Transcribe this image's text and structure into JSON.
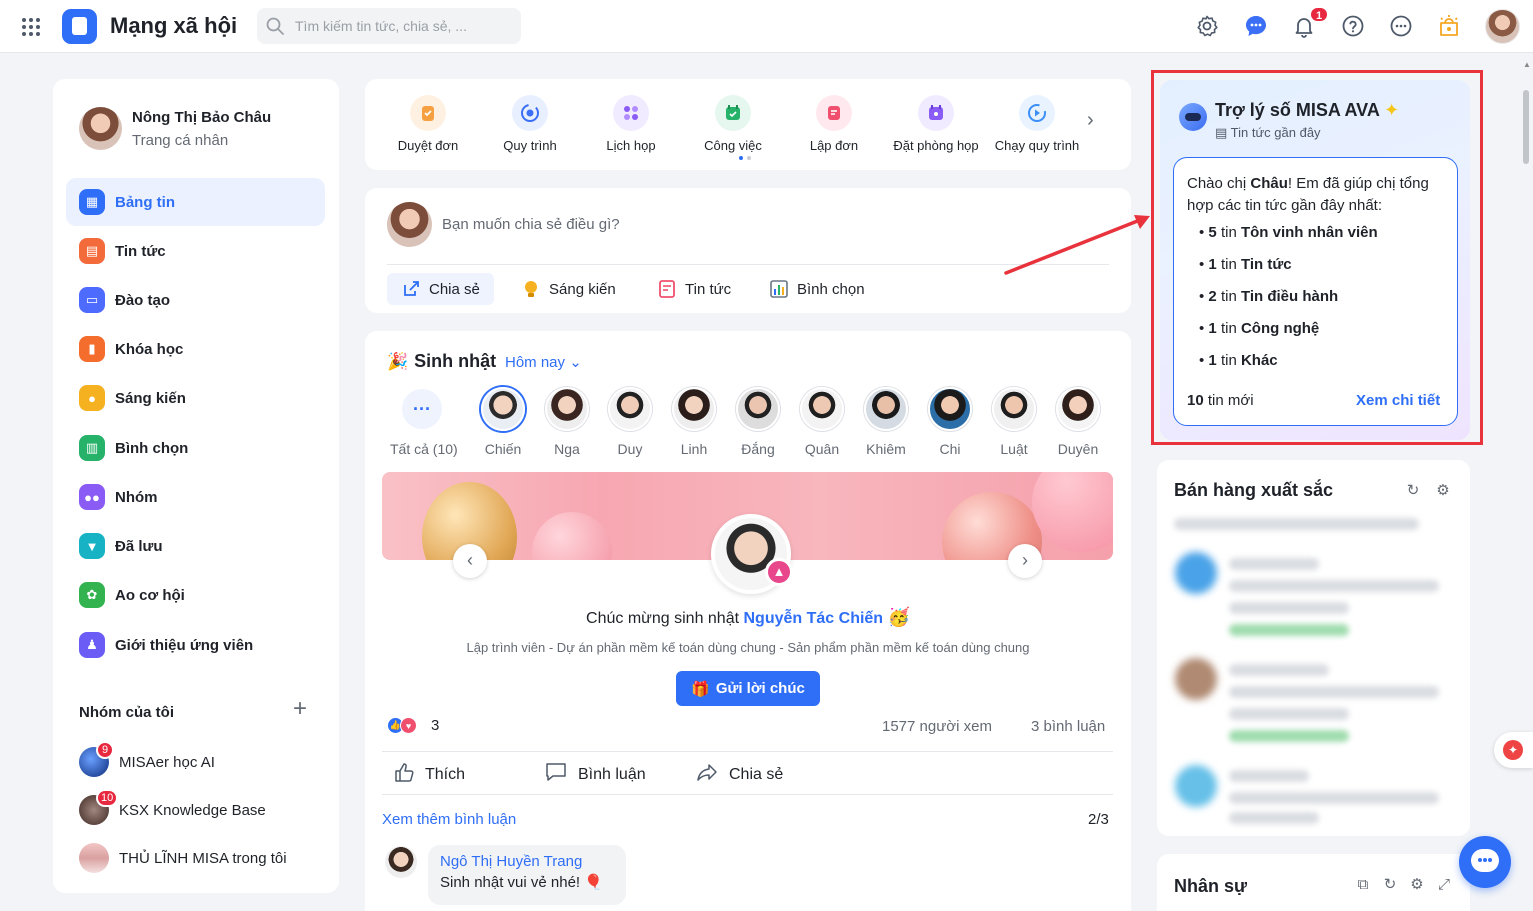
{
  "header": {
    "app_title": "Mạng xã hội",
    "search_placeholder": "Tìm kiếm tin tức, chia sẻ, ...",
    "notification_count": "1",
    "icons": [
      "grid-icon",
      "settings-icon",
      "chat-icon",
      "bell-icon",
      "help-icon",
      "more-icon",
      "lightbulb-icon"
    ]
  },
  "sidebar": {
    "profile": {
      "name": "Nông Thị Bảo Châu",
      "subtitle": "Trang cá nhân"
    },
    "menu": [
      {
        "label": "Bảng tin",
        "icon": "newsfeed-icon",
        "color": "#2f6ef6",
        "active": true
      },
      {
        "label": "Tin tức",
        "icon": "news-icon",
        "color": "#f36b3b"
      },
      {
        "label": "Đào tạo",
        "icon": "training-icon",
        "color": "#4d6bfe"
      },
      {
        "label": "Khóa học",
        "icon": "course-icon",
        "color": "#f56d2d"
      },
      {
        "label": "Sáng kiến",
        "icon": "idea-icon",
        "color": "#f5b120"
      },
      {
        "label": "Bình chọn",
        "icon": "poll-icon",
        "color": "#27b26a"
      },
      {
        "label": "Nhóm",
        "icon": "group-icon",
        "color": "#8a5cf5"
      },
      {
        "label": "Đã lưu",
        "icon": "bookmark-icon",
        "color": "#17b3c4"
      },
      {
        "label": "Ao cơ hội",
        "icon": "opportunity-icon",
        "color": "#32b350"
      },
      {
        "label": "Giới thiệu ứng viên",
        "icon": "referral-icon",
        "color": "#6a5cf5"
      }
    ],
    "groups_title": "Nhóm của tôi",
    "groups": [
      {
        "name": "MISAer học AI",
        "badge": "9"
      },
      {
        "name": "KSX Knowledge Base",
        "badge": "10"
      },
      {
        "name": "THỦ LĨNH MISA trong tôi",
        "badge": ""
      }
    ]
  },
  "apps": [
    {
      "label": "Duyệt đơn",
      "color": "#f5a142"
    },
    {
      "label": "Quy trình",
      "color": "#3b6ff6"
    },
    {
      "label": "Lịch họp",
      "color": "#8a5cf5"
    },
    {
      "label": "Công việc",
      "color": "#27b26a"
    },
    {
      "label": "Lập đơn",
      "color": "#f0506e"
    },
    {
      "label": "Đặt phòng họp",
      "color": "#8a5cf5"
    },
    {
      "label": "Chạy quy trình",
      "color": "#3b8ff6"
    }
  ],
  "composer": {
    "placeholder": "Bạn muốn chia sẻ điều gì?",
    "actions": [
      "Chia sẻ",
      "Sáng kiến",
      "Tin tức",
      "Bình chọn"
    ]
  },
  "birthday": {
    "title": "Sinh nhật",
    "filter": "Hôm nay",
    "people": [
      "Tất cả (10)",
      "Chiến",
      "Nga",
      "Duy",
      "Linh",
      "Đắng",
      "Quân",
      "Khiêm",
      "Chi",
      "Luật",
      "Duyên"
    ],
    "congrats_prefix": "Chúc mừng sinh nhật",
    "celebrant": "Nguyễn Tác Chiến",
    "job": "Lập trình viên - Dự án phần mềm kế toán dùng chung - Sản phẩm phần mềm kế toán dùng chung",
    "send_button": "Gửi lời chúc",
    "reaction_count": "3",
    "views": "1577 người xem",
    "comments": "3 bình luận",
    "actions": [
      "Thích",
      "Bình luận",
      "Chia sẻ"
    ],
    "more_comments": "Xem thêm bình luận",
    "pager": "2/3",
    "comment": {
      "author": "Ngô Thị Huyền Trang",
      "text": "Sinh nhật vui vẻ nhé!"
    }
  },
  "ava": {
    "title": "Trợ lý số MISA AVA",
    "subtitle": "Tin tức gần đây",
    "greet_1": "Chào chị ",
    "greet_name": "Châu",
    "greet_2": "! Em đã giúp chị tổng hợp các tin tức gần đây nhất:",
    "items": [
      {
        "count": "5",
        "unit": "tin",
        "topic": "Tôn vinh nhân viên"
      },
      {
        "count": "1",
        "unit": "tin",
        "topic": "Tin tức"
      },
      {
        "count": "2",
        "unit": "tin",
        "topic": "Tin điều hành"
      },
      {
        "count": "1",
        "unit": "tin",
        "topic": "Công nghệ"
      },
      {
        "count": "1",
        "unit": "tin",
        "topic": "Khác"
      }
    ],
    "new_count": "10",
    "new_label": "tin mới",
    "detail_link": "Xem chi tiết"
  },
  "sales": {
    "title": "Bán hàng xuất sắc"
  },
  "hr": {
    "title": "Nhân sự"
  }
}
